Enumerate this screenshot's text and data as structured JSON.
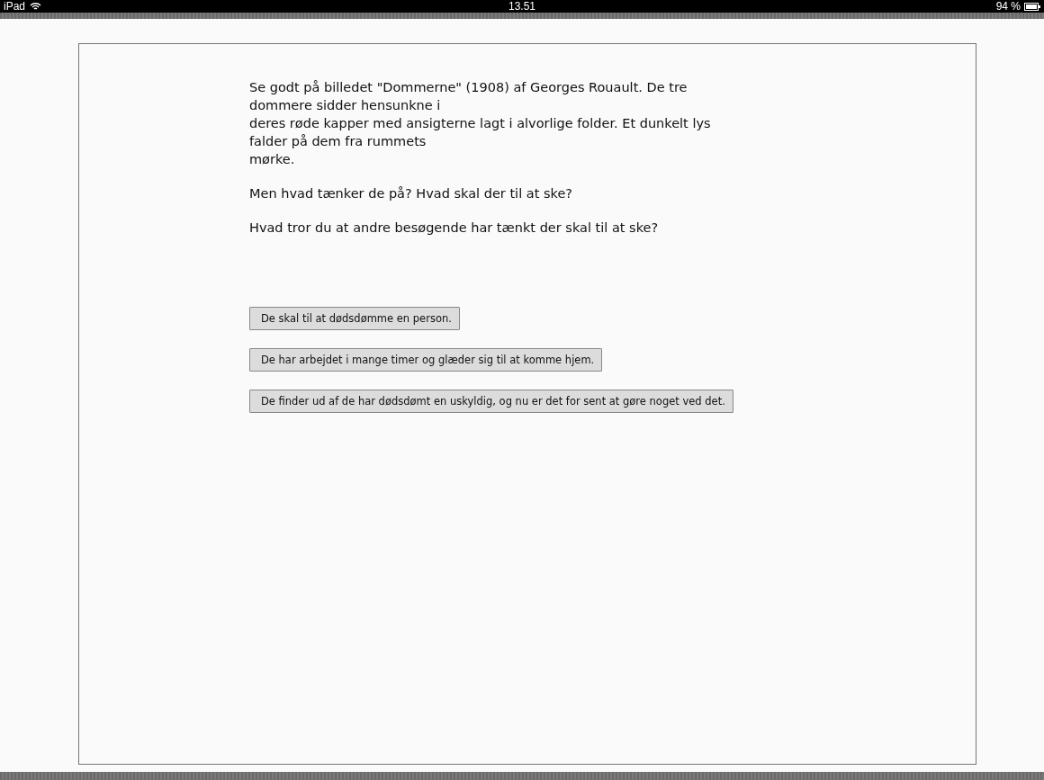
{
  "status_bar": {
    "device": "iPad",
    "time": "13.51",
    "battery": "94 %"
  },
  "intro_lines": [
    "Se godt på billedet \"Dommerne\" (1908) af Georges Rouault. De tre",
    "dommere sidder hensunkne i",
    "deres røde kapper med ansigterne lagt i alvorlige folder. Et dunkelt lys",
    "falder på dem fra rummets",
    "mørke."
  ],
  "questions": [
    "Men hvad tænker de på? Hvad skal der til at ske?",
    "Hvad tror du at andre besøgende har tænkt der skal til at ske?"
  ],
  "answers": [
    "De skal til at dødsdømme en person.",
    "De har arbejdet i mange timer og glæder sig til at komme hjem.",
    "De finder ud af de har dødsdømt en uskyldig, og nu er det for sent at gøre noget ved det."
  ]
}
